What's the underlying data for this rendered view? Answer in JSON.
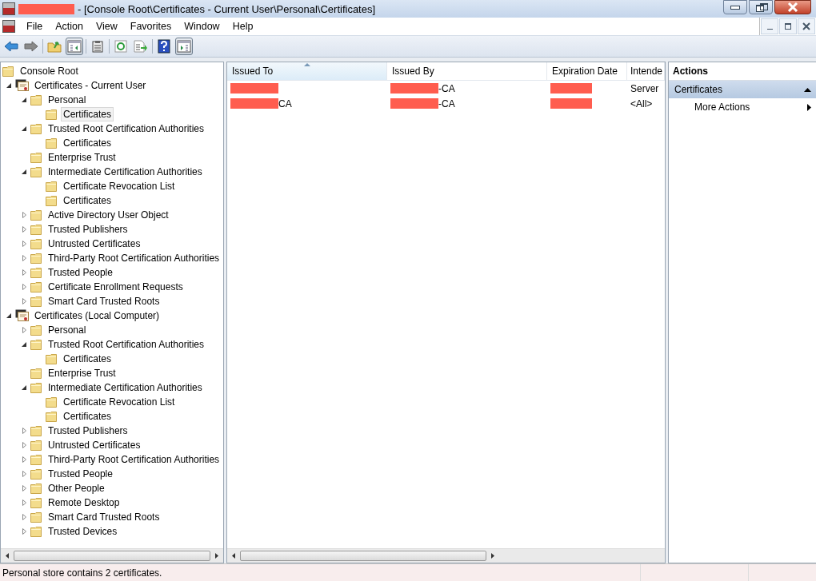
{
  "window": {
    "title": {
      "redacted": true,
      "text": "- [Console Root\\Certificates - Current User\\Personal\\Certificates]"
    }
  },
  "menu": [
    "File",
    "Action",
    "View",
    "Favorites",
    "Window",
    "Help"
  ],
  "toolbar": [
    {
      "kind": "back",
      "pressed": false
    },
    {
      "kind": "forward",
      "pressed": false
    },
    {
      "kind": "sep"
    },
    {
      "kind": "up",
      "pressed": false
    },
    {
      "kind": "tree",
      "pressed": true
    },
    {
      "kind": "sep"
    },
    {
      "kind": "clip",
      "pressed": false
    },
    {
      "kind": "sep"
    },
    {
      "kind": "refresh",
      "pressed": false
    },
    {
      "kind": "export",
      "pressed": false
    },
    {
      "kind": "sep"
    },
    {
      "kind": "help",
      "pressed": false
    },
    {
      "kind": "actionpane",
      "pressed": true
    }
  ],
  "tree": [
    {
      "label": "Console Root",
      "kind": "folder",
      "selected": false,
      "children": [
        {
          "label": "Certificates - Current User",
          "kind": "store",
          "expanded": true,
          "selected": false,
          "children": [
            {
              "label": "Personal",
              "kind": "folder",
              "expanded": true,
              "selected": false,
              "children": [
                {
                  "label": "Certificates",
                  "kind": "folder",
                  "selected": true
                }
              ]
            },
            {
              "label": "Trusted Root Certification Authorities",
              "kind": "folder",
              "expanded": true,
              "selected": false,
              "children": [
                {
                  "label": "Certificates",
                  "kind": "folder",
                  "selected": false
                }
              ]
            },
            {
              "label": "Enterprise Trust",
              "kind": "folder",
              "selected": false
            },
            {
              "label": "Intermediate Certification Authorities",
              "kind": "folder",
              "expanded": true,
              "selected": false,
              "children": [
                {
                  "label": "Certificate Revocation List",
                  "kind": "folder",
                  "selected": false
                },
                {
                  "label": "Certificates",
                  "kind": "folder",
                  "selected": false
                }
              ]
            },
            {
              "label": "Active Directory User Object",
              "kind": "folder",
              "expanded": false,
              "selected": false
            },
            {
              "label": "Trusted Publishers",
              "kind": "folder",
              "expanded": false,
              "selected": false
            },
            {
              "label": "Untrusted Certificates",
              "kind": "folder",
              "expanded": false,
              "selected": false
            },
            {
              "label": "Third-Party Root Certification Authorities",
              "kind": "folder",
              "expanded": false,
              "selected": false
            },
            {
              "label": "Trusted People",
              "kind": "folder",
              "expanded": false,
              "selected": false
            },
            {
              "label": "Certificate Enrollment Requests",
              "kind": "folder",
              "expanded": false,
              "selected": false
            },
            {
              "label": "Smart Card Trusted Roots",
              "kind": "folder",
              "expanded": false,
              "selected": false
            }
          ]
        },
        {
          "label": "Certificates (Local Computer)",
          "kind": "store",
          "expanded": true,
          "selected": false,
          "children": [
            {
              "label": "Personal",
              "kind": "folder",
              "expanded": false,
              "selected": false
            },
            {
              "label": "Trusted Root Certification Authorities",
              "kind": "folder",
              "expanded": true,
              "selected": false,
              "children": [
                {
                  "label": "Certificates",
                  "kind": "folder",
                  "selected": false
                }
              ]
            },
            {
              "label": "Enterprise Trust",
              "kind": "folder",
              "selected": false
            },
            {
              "label": "Intermediate Certification Authorities",
              "kind": "folder",
              "expanded": true,
              "selected": false,
              "children": [
                {
                  "label": "Certificate Revocation List",
                  "kind": "folder",
                  "selected": false
                },
                {
                  "label": "Certificates",
                  "kind": "folder",
                  "selected": false
                }
              ]
            },
            {
              "label": "Trusted Publishers",
              "kind": "folder",
              "expanded": false,
              "selected": false
            },
            {
              "label": "Untrusted Certificates",
              "kind": "folder",
              "expanded": false,
              "selected": false
            },
            {
              "label": "Third-Party Root Certification Authorities",
              "kind": "folder",
              "expanded": false,
              "selected": false
            },
            {
              "label": "Trusted People",
              "kind": "folder",
              "expanded": false,
              "selected": false
            },
            {
              "label": "Other People",
              "kind": "folder",
              "expanded": false,
              "selected": false
            },
            {
              "label": "Remote Desktop",
              "kind": "folder",
              "expanded": false,
              "selected": false
            },
            {
              "label": "Smart Card Trusted Roots",
              "kind": "folder",
              "expanded": false,
              "selected": false
            },
            {
              "label": "Trusted Devices",
              "kind": "folder",
              "expanded": false,
              "selected": false
            }
          ]
        }
      ]
    }
  ],
  "table": {
    "columns": [
      {
        "label": "Issued To",
        "sorted": true
      },
      {
        "label": "Issued By",
        "sorted": false
      },
      {
        "label": "Expiration Date",
        "sorted": false
      },
      {
        "label": "Intende",
        "sorted": false
      }
    ],
    "rows": [
      {
        "cells": [
          {
            "redacted": true
          },
          {
            "redacted": true,
            "text": "-CA"
          },
          {
            "redacted": true
          },
          {
            "redacted": false,
            "text": "Server"
          }
        ]
      },
      {
        "cells": [
          {
            "redacted": true,
            "text": "CA"
          },
          {
            "redacted": true,
            "text": "-CA"
          },
          {
            "redacted": true
          },
          {
            "redacted": false,
            "text": "<All>"
          }
        ]
      }
    ]
  },
  "actions": {
    "title": "Actions",
    "section": "Certificates",
    "items": [
      "More Actions"
    ]
  },
  "status_bar": "Personal store contains 2 certificates."
}
